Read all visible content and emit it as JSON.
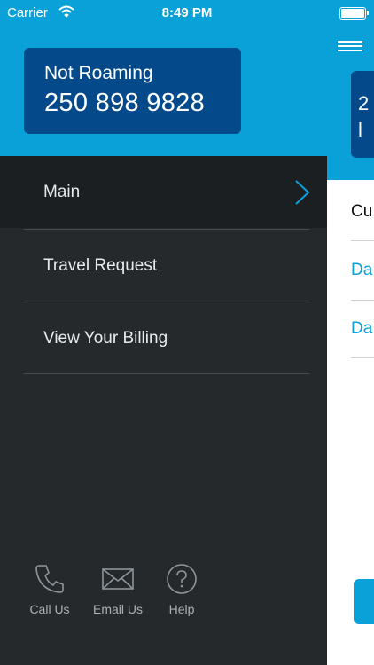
{
  "status_bar": {
    "carrier": "Carrier",
    "time": "8:49 PM"
  },
  "account": {
    "roaming_status": "Not Roaming",
    "phone_number": "250 898 9828"
  },
  "menu": {
    "items": [
      {
        "label": "Main",
        "active": true
      },
      {
        "label": "Travel Request",
        "active": false
      },
      {
        "label": "View Your Billing",
        "active": false
      }
    ]
  },
  "footer": {
    "call_label": "Call Us",
    "email_label": "Email Us",
    "help_label": "Help"
  },
  "background_screen": {
    "card_line1": "2",
    "card_line2": "l",
    "row1": "Cu",
    "row2": "Da",
    "row3": "Da"
  },
  "colors": {
    "accent_blue": "#0aa1d8",
    "card_navy": "#044a8b",
    "menu_bg": "#25292c",
    "active_bg": "#1c1f21"
  }
}
